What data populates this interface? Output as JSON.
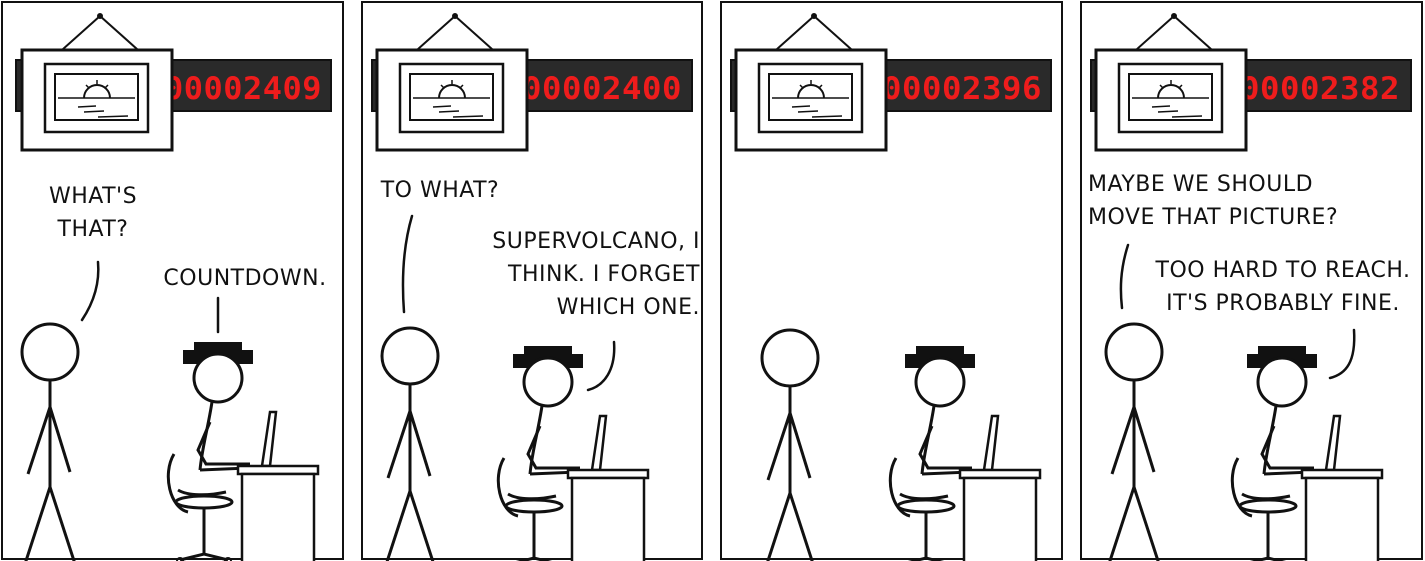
{
  "panels": [
    {
      "countdown": "00002409",
      "dialogue": {
        "standing_man": [
          "WHAT'S",
          "THAT?"
        ],
        "seated_man": [
          "COUNTDOWN."
        ]
      }
    },
    {
      "countdown": "00002400",
      "dialogue": {
        "standing_man": [
          "TO WHAT?"
        ],
        "seated_man": [
          "SUPERVOLCANO, I",
          "THINK. I FORGET",
          "WHICH ONE."
        ]
      }
    },
    {
      "countdown": "00002396",
      "dialogue": {
        "standing_man": [],
        "seated_man": []
      }
    },
    {
      "countdown": "00002382",
      "dialogue": {
        "standing_man": [
          "MAYBE WE SHOULD",
          "MOVE THAT PICTURE?"
        ],
        "seated_man": [
          "TOO HARD TO REACH.",
          "IT'S PROBABLY FINE."
        ]
      }
    }
  ],
  "colors": {
    "ink": "#111111",
    "display_background": "#2a2a2a",
    "display_digits": "#ee1c1c",
    "paper": "#ffffff"
  }
}
